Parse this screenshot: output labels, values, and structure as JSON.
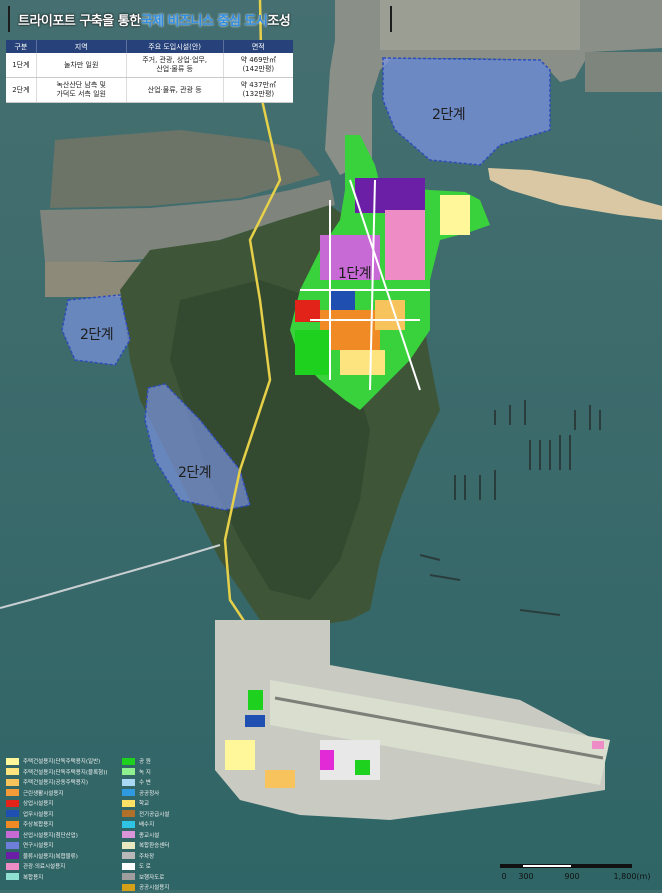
{
  "title": {
    "part1": "트라이포트 구축을 통한 ",
    "part2": "국제 비즈니스 중심 도시",
    "part3": " 조성"
  },
  "table": {
    "headers": [
      "구분",
      "지역",
      "주요 도입시설(안)",
      "면적"
    ],
    "rows": [
      {
        "phase": "1단계",
        "area": "눌차만 일원",
        "facilities_line1": "주거, 관광, 상업·업무,",
        "facilities_line2": "산업·물류 등",
        "size_line1": "약 469만㎡",
        "size_line2": "(142만평)"
      },
      {
        "phase": "2단계",
        "area_line1": "녹산산단 남측 및",
        "area_line2": "가덕도 서측 일원",
        "facilities": "산업·물류, 관광 등",
        "size_line1": "약 437만㎡",
        "size_line2": "(132만평)"
      }
    ]
  },
  "phase_labels": {
    "phase1": "1단계",
    "phase2_east": "2단계",
    "phase2_west": "2단계",
    "phase2_south": "2단계"
  },
  "legend": {
    "left": [
      {
        "label": "주택건설용지(단독주택용지(일반)",
        "color": "#fff799"
      },
      {
        "label": "주택건설용지(단독주택용지(블록형))",
        "color": "#fde47f"
      },
      {
        "label": "주택건설용지(공동주택용지)",
        "color": "#f7c35c"
      },
      {
        "label": "근린생활시설용지",
        "color": "#f29b38"
      },
      {
        "label": "상업시설용지",
        "color": "#e2231a"
      },
      {
        "label": "업무시설용지",
        "color": "#1f4fb0"
      },
      {
        "label": "주상복합용지",
        "color": "#f08a24"
      },
      {
        "label": "산업시설용지(첨단산업)",
        "color": "#c86ad6"
      },
      {
        "label": "연구시설용지",
        "color": "#6d7fd8"
      },
      {
        "label": "물류시설용지(복합물류)",
        "color": "#6a1fa6"
      },
      {
        "label": "관광·의료시설용지",
        "color": "#ee8cc6"
      },
      {
        "label": "복합용지",
        "color": "#8fe0d0"
      }
    ],
    "right": [
      {
        "label": "공 원",
        "color": "#1fd11f"
      },
      {
        "label": "녹 지",
        "color": "#8ef08e"
      },
      {
        "label": "수 변",
        "color": "#a9d8f5"
      },
      {
        "label": "공공청사",
        "color": "#2f9ae0"
      },
      {
        "label": "학교",
        "color": "#ffe066"
      },
      {
        "label": "전기공급시설",
        "color": "#b0702a"
      },
      {
        "label": "배수지",
        "color": "#2fc4e4"
      },
      {
        "label": "종교시설",
        "color": "#d995d8"
      },
      {
        "label": "복합환승센터",
        "color": "#e8e8c0"
      },
      {
        "label": "주차장",
        "color": "#b8b8b8"
      },
      {
        "label": "도 로",
        "color": "#ffffff"
      },
      {
        "label": "보행자도로",
        "color": "#9e9e9e"
      },
      {
        "label": "공공시설용지",
        "color": "#d4a017"
      }
    ]
  },
  "scale": {
    "ticks": [
      "0",
      "300",
      "900",
      "1,800(m)"
    ]
  },
  "colors": {
    "sea": "#3f6e6f",
    "island": "#3d5236",
    "phase1_green": "#39d23c",
    "phase2_fill": "#7b93e0",
    "runway": "#cfd6c7",
    "header_navy": "#27427a"
  }
}
